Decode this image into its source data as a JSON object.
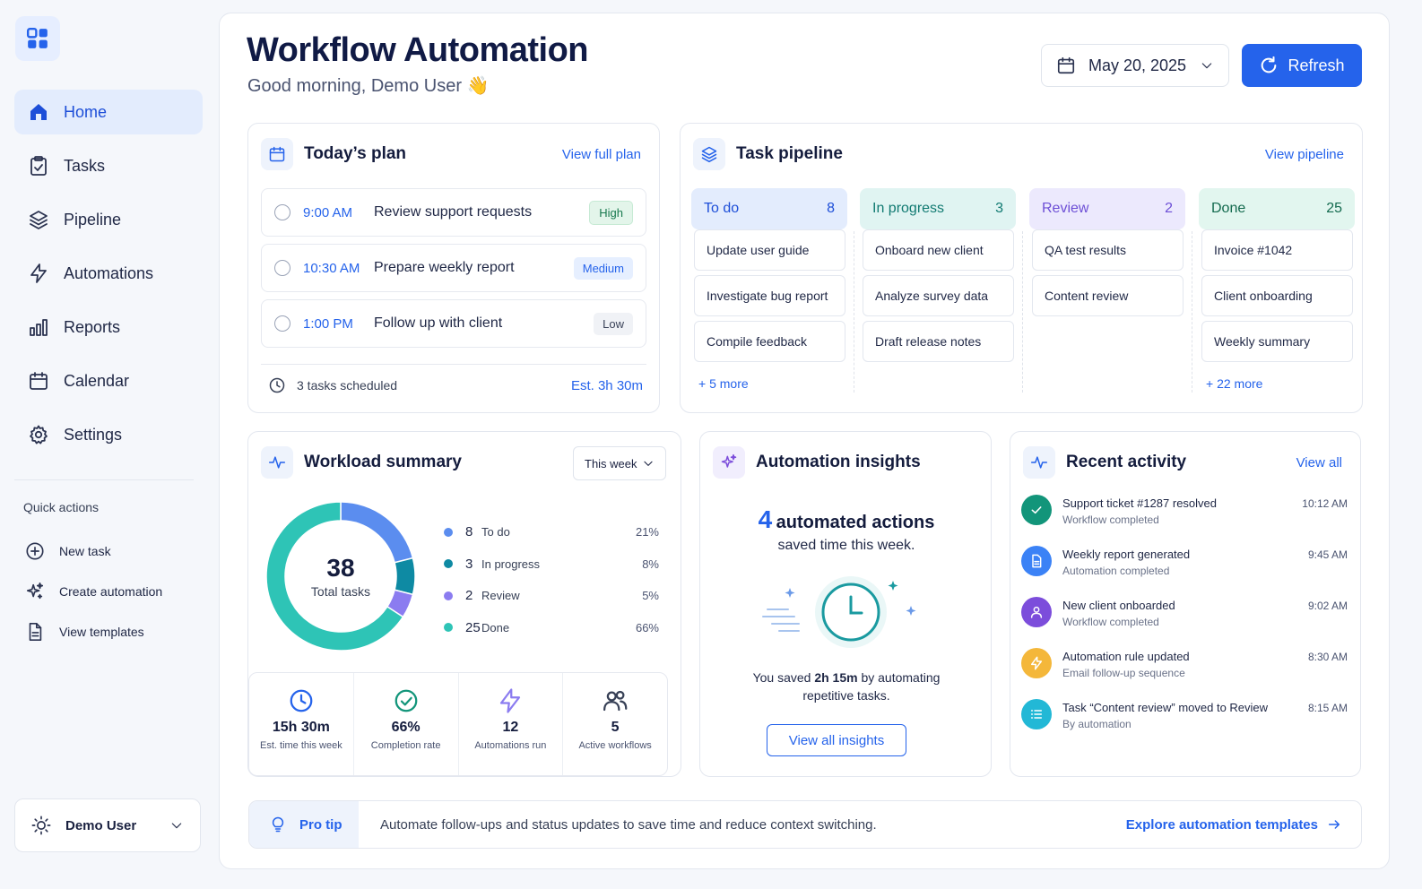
{
  "sidebar": {
    "nav": [
      {
        "label": "Home",
        "icon": "home-icon"
      },
      {
        "label": "Tasks",
        "icon": "clipboard-check-icon"
      },
      {
        "label": "Pipeline",
        "icon": "layers-icon"
      },
      {
        "label": "Automations",
        "icon": "lightning-icon"
      },
      {
        "label": "Reports",
        "icon": "bar-chart-icon"
      },
      {
        "label": "Calendar",
        "icon": "calendar-icon"
      },
      {
        "label": "Settings",
        "icon": "gear-icon"
      }
    ],
    "quick_actions_title": "Quick actions",
    "quick_actions": [
      {
        "label": "New task",
        "icon": "plus-circle-icon"
      },
      {
        "label": "Create automation",
        "icon": "sparkle-icon"
      },
      {
        "label": "View templates",
        "icon": "document-icon"
      }
    ],
    "user_name": "Demo User"
  },
  "header": {
    "title": "Workflow Automation",
    "greeting": "Good morning, Demo User 👋",
    "date": "May 20, 2025",
    "refresh_label": "Refresh"
  },
  "plan": {
    "title": "Today’s plan",
    "link": "View full plan",
    "items": [
      {
        "time": "9:00 AM",
        "task": "Review support requests",
        "priority": "High"
      },
      {
        "time": "10:30 AM",
        "task": "Prepare weekly report",
        "priority": "Medium"
      },
      {
        "time": "1:00 PM",
        "task": "Follow up with client",
        "priority": "Low"
      }
    ],
    "footer_left": "3 tasks scheduled",
    "footer_right": "Est. 3h 30m"
  },
  "pipeline": {
    "title": "Task pipeline",
    "link": "View pipeline",
    "columns": [
      {
        "name": "To do",
        "count": "8",
        "cards": [
          "Update user guide",
          "Investigate bug report",
          "Compile feedback"
        ],
        "more": "+ 5 more"
      },
      {
        "name": "In progress",
        "count": "3",
        "cards": [
          "Onboard new client",
          "Analyze survey data",
          "Draft release notes"
        ],
        "more": ""
      },
      {
        "name": "Review",
        "count": "2",
        "cards": [
          "QA test results",
          "Content review"
        ],
        "more": ""
      },
      {
        "name": "Done",
        "count": "25",
        "cards": [
          "Invoice #1042",
          "Client onboarding",
          "Weekly summary"
        ],
        "more": "+ 22 more"
      }
    ]
  },
  "workload": {
    "title": "Workload summary",
    "range": "This week",
    "total": "38",
    "total_label": "Total tasks",
    "legend": [
      {
        "count": "8",
        "label": "To do",
        "pct": "21%",
        "color": "#5b8def"
      },
      {
        "count": "3",
        "label": "In progress",
        "pct": "8%",
        "color": "#0e8aa3"
      },
      {
        "count": "2",
        "label": "Review",
        "pct": "5%",
        "color": "#8b7cf0"
      },
      {
        "count": "25",
        "label": "Done",
        "pct": "66%",
        "color": "#2ec4b6"
      }
    ],
    "stats": [
      {
        "value": "15h 30m",
        "label": "Est. time this week",
        "icon": "clock-icon"
      },
      {
        "value": "66%",
        "label": "Completion rate",
        "icon": "check-circle-icon"
      },
      {
        "value": "12",
        "label": "Automations run",
        "icon": "lightning-icon"
      },
      {
        "value": "5",
        "label": "Active workflows",
        "icon": "users-icon"
      }
    ]
  },
  "chart_data": {
    "type": "pie",
    "categories": [
      "To do",
      "In progress",
      "Review",
      "Done"
    ],
    "values": [
      8,
      3,
      2,
      25
    ]
  },
  "insights": {
    "title": "Automation insights",
    "count": "4",
    "headline": "automated actions",
    "sub": "saved time this week.",
    "saved_prefix": "You saved ",
    "saved_value": "2h 15m",
    "saved_suffix": " by automating repetitive tasks.",
    "button": "View all insights"
  },
  "activity": {
    "title": "Recent activity",
    "link": "View all",
    "items": [
      {
        "title": "Support ticket #1287 resolved",
        "sub": "Workflow completed",
        "time": "10:12 AM",
        "color": "#12957a",
        "icon": "check-icon"
      },
      {
        "title": "Weekly report generated",
        "sub": "Automation completed",
        "time": "9:45 AM",
        "color": "#3b82f6",
        "icon": "document-icon"
      },
      {
        "title": "New client onboarded",
        "sub": "Workflow completed",
        "time": "9:02 AM",
        "color": "#7c4ddb",
        "icon": "user-icon"
      },
      {
        "title": "Automation rule updated",
        "sub": "Email follow-up sequence",
        "time": "8:30 AM",
        "color": "#f4b73a",
        "icon": "lightning-icon"
      },
      {
        "title": "Task “Content review” moved to Review",
        "sub": "By automation",
        "time": "8:15 AM",
        "color": "#22b8d6",
        "icon": "list-icon"
      }
    ]
  },
  "tip": {
    "label": "Pro tip",
    "message": "Automate follow-ups and status updates to save time and reduce context switching.",
    "link": "Explore automation templates"
  },
  "colors": {
    "accent": "#2563eb",
    "col_todo_bg": "#e3ecfd",
    "col_progress_bg": "#e0f4f2",
    "col_review_bg": "#ece9fd",
    "col_done_bg": "#e2f6ef",
    "col_todo_text": "#1d4ed8",
    "col_progress_text": "#117a72",
    "col_review_text": "#6d4fd6",
    "col_done_text": "#136a4e"
  }
}
